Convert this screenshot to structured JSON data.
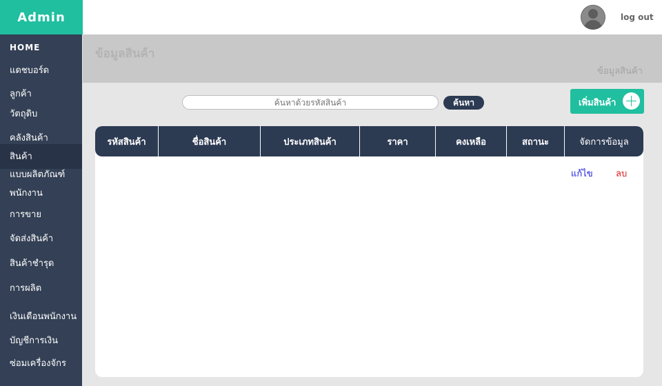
{
  "app": {
    "brand": "Admin"
  },
  "topbar": {
    "logout_label": "log out"
  },
  "sidebar": {
    "items": [
      {
        "label": "HOME"
      },
      {
        "label": "แดชบอร์ด"
      },
      {
        "label": "ลูกค้า"
      },
      {
        "label": "วัตถุดิบ"
      },
      {
        "label": "คลังสินค้า"
      },
      {
        "label": "สินค้า"
      },
      {
        "label": "แบบผลิตภัณฑ์"
      },
      {
        "label": "พนักงาน"
      },
      {
        "label": "การขาย"
      },
      {
        "label": "จัดส่งสินค้า"
      },
      {
        "label": "สินค้าชำรุด"
      },
      {
        "label": "การผลิต"
      },
      {
        "label": "เงินเดือนพนักงาน"
      },
      {
        "label": "บัญชีการเงิน"
      },
      {
        "label": "ซ่อมเครื่องจักร"
      }
    ]
  },
  "header": {
    "title": "ข้อมูลสินค้า",
    "breadcrumb": "ข้อมูลสินค้า"
  },
  "search": {
    "placeholder": "ค้นหาด้วยรหัสสินค้า",
    "button_label": "ค้นหา"
  },
  "add_button": {
    "label": "เพิ่มสินค้า"
  },
  "table": {
    "columns": [
      "รหัสสินค้า",
      "ชื่อสินค้า",
      "ประเภทสินค้า",
      "ราคา",
      "คงเหลือ",
      "สถานะ",
      "จัดการข้อมูล"
    ],
    "row_actions": {
      "edit": "แก้ไข",
      "delete": "ลบ"
    }
  },
  "colors": {
    "accent": "#1fbf9f",
    "sidebar": "#334055",
    "table_header": "#2c3a52",
    "edit": "#1a1adc",
    "delete": "#d81b1b"
  }
}
